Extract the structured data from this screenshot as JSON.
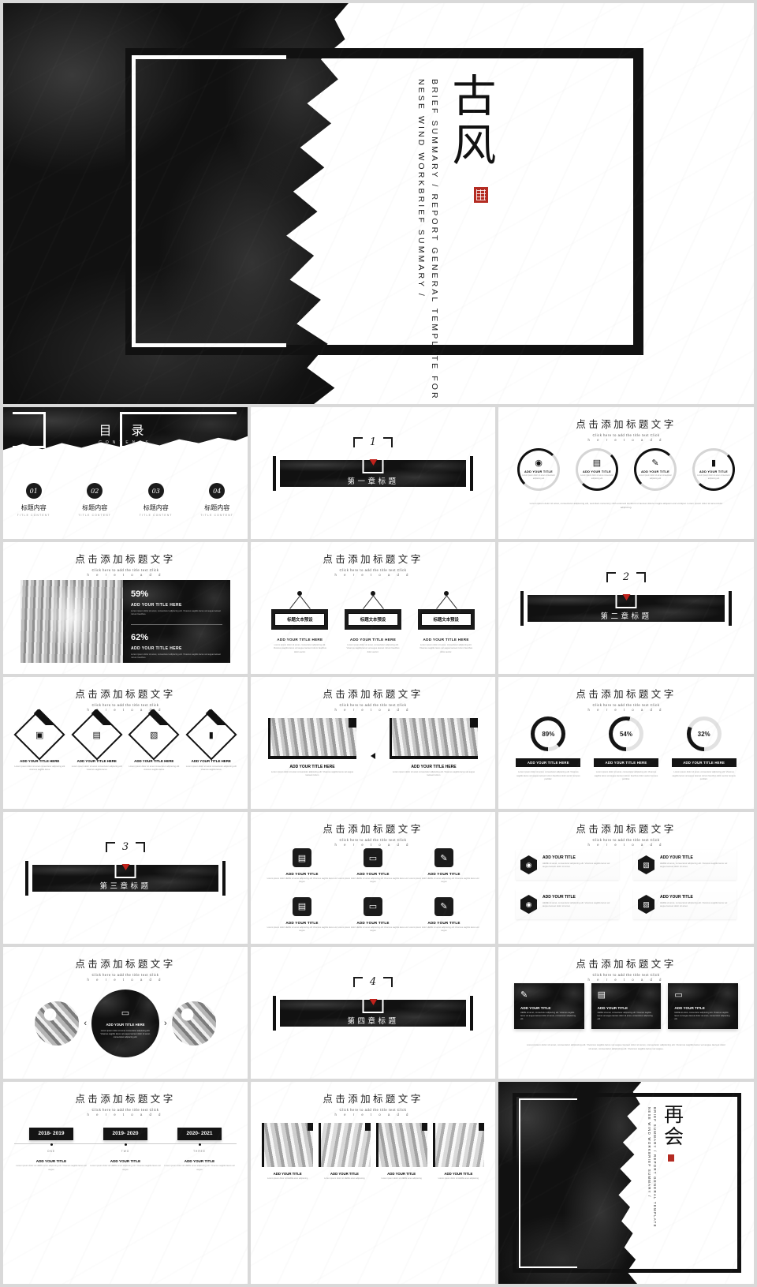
{
  "cover": {
    "title_cn": "古风",
    "vertical_line_1": "BRIEF SUMMARY / REPORT GENERAL TEMPLATE FOR",
    "vertical_line_2": "NESE WIND WORKBRIEF SUMMARY /",
    "seal_name": "red-seal-stamp"
  },
  "toc": {
    "title_cn": "目 录",
    "title_en": "CONTENTS",
    "items": [
      {
        "num": "01",
        "cn": "标题内容",
        "en": "TITLE CONTENT"
      },
      {
        "num": "02",
        "cn": "标题内容",
        "en": "TITLE CONTENT"
      },
      {
        "num": "03",
        "cn": "标题内容",
        "en": "TITLE CONTENT"
      },
      {
        "num": "04",
        "cn": "标题内容",
        "en": "TITLE CONTENT"
      }
    ]
  },
  "section_header": {
    "cn": "点击添加标题文字",
    "en_line1": "Click here to add the title text Click",
    "en_line2": "h e r e   t o   a d d"
  },
  "chapters": [
    {
      "num": "1",
      "title": "第一章标题"
    },
    {
      "num": "2",
      "title": "第二章标题"
    },
    {
      "num": "3",
      "title": "第三章标题"
    },
    {
      "num": "4",
      "title": "第四章标题"
    }
  ],
  "lorem_short": "Lorem ipsum dolor sit amet, consectetur adipiscing elit. Vivamus sagittis lacus vel augue.",
  "lorem_medium": "Lorem ipsum dolor sit amet, consectetur adipiscing elit. Vivamus sagittis lacus vel augue laoreet rutrum faucibus dolor auctor.",
  "lorem_long": "Lorem ipsum dolor sit amet, consectetur adipiscing elit. Vivamus sagittis lacus vel augue laoreet rutrum faucibus dolor auctor. Lorem ipsum dolor sit amet, consectetur adipiscing elit. Vivamus sagittis lacus vel augue laoreet rutrum faucibus dolor auctor.",
  "circles_slide": {
    "items": [
      {
        "icon": "search-target-icon",
        "glyph": "◉",
        "title": "ADD YOUR TITLE",
        "desc": "Lorem ipsum dolor sit amet consectetur adipiscing elit"
      },
      {
        "icon": "layers-icon",
        "glyph": "▤",
        "title": "ADD YOUR TITLE",
        "desc": "Lorem ipsum dolor sit amet consectetur adipiscing elit"
      },
      {
        "icon": "edit-document-icon",
        "glyph": "✎",
        "title": "ADD YOUR TITLE",
        "desc": "Lorem ipsum dolor sit amet consectetur adipiscing elit"
      },
      {
        "icon": "bar-chart-icon",
        "glyph": "▮",
        "title": "ADD YOUR TITLE",
        "desc": "Lorem ipsum dolor sit amet consectetur adipiscing elit"
      }
    ],
    "footer": "Lorem ipsum dolor sit amet, consectetur adipiscing elit, sed diam nonummy nibh euismod tincidunt ut laoreet dolore magna aliquam erat volutpat. Lorem ipsum dolor sit amet dolor adipiscing."
  },
  "stats_slide": {
    "stats": [
      {
        "value": "59%",
        "title": "ADD YOUR TITLE HERE",
        "desc": "Lorem ipsum dolor sit amet, consectetur adipiscing elit. Vivamus sagittis lacus vel augue laoreet rutrum faucibus."
      },
      {
        "value": "62%",
        "title": "ADD YOUR TITLE HERE",
        "desc": "Lorem ipsum dolor sit amet, consectetur adipiscing elit. Vivamus sagittis lacus vel augue laoreet rutrum faucibus."
      }
    ],
    "photo_name": "architecture-corridor-photo"
  },
  "tags_slide": {
    "tags": [
      {
        "plate": "标题文本预设",
        "title": "ADD YOUR TITLE HERE",
        "desc": "Lorem ipsum dolor sit amet, consectetur adipiscing elit. Vivamus sagittis lacus vel augue laoreet rutrum faucibus dolor auctor."
      },
      {
        "plate": "标题文本预设",
        "title": "ADD YOUR TITLE HERE",
        "desc": "Lorem ipsum dolor sit amet, consectetur adipiscing elit. Vivamus sagittis lacus vel augue laoreet rutrum faucibus dolor auctor."
      },
      {
        "plate": "标题文本预设",
        "title": "ADD YOUR TITLE HERE",
        "desc": "Lorem ipsum dolor sit amet, consectetur adipiscing elit. Vivamus sagittis lacus vel augue laoreet rutrum faucibus dolor auctor."
      }
    ]
  },
  "diamonds_slide": {
    "items": [
      {
        "icon": "briefcase-icon",
        "glyph": "▣",
        "title": "ADD YOUR TITLE HERE",
        "desc": "Lorem ipsum dolor sit amet consectetur adipiscing elit vivamus sagittis lacus"
      },
      {
        "icon": "layers-icon",
        "glyph": "▤",
        "title": "ADD YOUR TITLE HERE",
        "desc": "Lorem ipsum dolor sit amet consectetur adipiscing elit vivamus sagittis lacus"
      },
      {
        "icon": "inbox-icon",
        "glyph": "▧",
        "title": "ADD YOUR TITLE HERE",
        "desc": "Lorem ipsum dolor sit amet consectetur adipiscing elit vivamus sagittis lacus"
      },
      {
        "icon": "bar-chart-icon",
        "glyph": "▮",
        "title": "ADD YOUR TITLE HERE",
        "desc": "Lorem ipsum dolor sit amet consectetur adipiscing elit vivamus sagittis lacus"
      }
    ]
  },
  "compare_slide": {
    "items": [
      {
        "title": "ADD YOUR TITLE HERE",
        "desc": "Lorem ipsum dolor sit amet consectetur adipiscing elit. Vivamus sagittis lacus vel augue laoreet rutrum"
      },
      {
        "title": "ADD YOUR TITLE HERE",
        "desc": "Lorem ipsum dolor sit amet consectetur adipiscing elit. Vivamus sagittis lacus vel augue laoreet rutrum"
      }
    ]
  },
  "chart_data": {
    "type": "pie",
    "title": "点击添加标题文字",
    "subtitle": "Click here to add the title text Click here to add",
    "categories": [
      "ADD YOUR TITLE HERE",
      "ADD YOUR TITLE HERE",
      "ADD YOUR TITLE HERE"
    ],
    "values": [
      89,
      54,
      32
    ],
    "labels": [
      "89%",
      "54%",
      "32%"
    ],
    "unit": "%",
    "ylim": [
      0,
      100
    ],
    "legend": "none",
    "grid": false,
    "descriptions": [
      "Lorem ipsum dolor sit amet, consectetur adipiscing elit. Vivamus sagittis lacus vel augue laoreet rutrum faucibus dolor auctor tempus porttitor.",
      "Lorem ipsum dolor sit amet, consectetur adipiscing elit. Vivamus sagittis lacus vel augue laoreet rutrum faucibus dolor auctor tempus porttitor.",
      "Lorem ipsum dolor sit amet, consectetur adipiscing elit. Vivamus sagittis lacus vel augue laoreet rutrum faucibus dolor auctor tempus porttitor."
    ]
  },
  "icon_grid_slide": {
    "items": [
      {
        "icon": "layers-icon",
        "glyph": "▤",
        "title": "ADD YOUR TITLE",
        "desc": "Lorem ipsum dolor HERE sit amet adipiscing elit Vivamus sagittis lacus vel augue"
      },
      {
        "icon": "monitor-icon",
        "glyph": "▭",
        "title": "ADD YOUR TITLE",
        "desc": "Lorem ipsum dolor HERE sit amet adipiscing elit Vivamus sagittis lacus vel augue"
      },
      {
        "icon": "edit-document-icon",
        "glyph": "✎",
        "title": "ADD YOUR TITLE",
        "desc": "Lorem ipsum dolor HERE sit amet adipiscing elit Vivamus sagittis lacus vel augue"
      },
      {
        "icon": "layers-icon",
        "glyph": "▤",
        "title": "ADD YOUR TITLE",
        "desc": "Lorem ipsum dolor HERE sit amet adipiscing elit Vivamus sagittis lacus vel augue"
      },
      {
        "icon": "monitor-icon",
        "glyph": "▭",
        "title": "ADD YOUR TITLE",
        "desc": "Lorem ipsum dolor HERE sit amet adipiscing elit Vivamus sagittis lacus vel augue"
      },
      {
        "icon": "edit-document-icon",
        "glyph": "✎",
        "title": "ADD YOUR TITLE",
        "desc": "Lorem ipsum dolor HERE sit amet adipiscing elit Vivamus sagittis lacus vel augue"
      }
    ]
  },
  "hexagon_slide": {
    "items": [
      {
        "icon": "search-target-icon",
        "glyph": "◉",
        "title": "ADD YOUR TITLE",
        "desc": "HERE sit amet, consectetur adipiscing elit. Vivamus sagittis lacus vel augue laoreet dolor sit amet."
      },
      {
        "icon": "inbox-icon",
        "glyph": "▧",
        "title": "ADD YOUR TITLE",
        "desc": "HERE sit amet, consectetur adipiscing elit. Vivamus sagittis lacus vel augue laoreet dolor sit amet."
      },
      {
        "icon": "search-target-icon",
        "glyph": "◉",
        "title": "ADD YOUR TITLE",
        "desc": "HERE sit amet, consectetur adipiscing elit. Vivamus sagittis lacus vel augue laoreet dolor sit amet."
      },
      {
        "icon": "inbox-icon",
        "glyph": "▧",
        "title": "ADD YOUR TITLE",
        "desc": "HERE sit amet, consectetur adipiscing elit. Vivamus sagittis lacus vel augue laoreet dolor sit amet."
      }
    ]
  },
  "carousel_slide": {
    "prev_label": "‹",
    "next_label": "›",
    "center": {
      "icon": "monitor-icon",
      "glyph": "▭",
      "title": "ADD YOUR TITLE HERE",
      "desc": "Lorem ipsum dolor sit amet consectetur adipiscing elit. Vivamus sagittis lacus vel augue laoreet dolor sit amet, consectetur adipiscing elit."
    },
    "left_image": "sailboat-photo",
    "right_image": "sailboat-photo"
  },
  "dark_cards_slide": {
    "cards": [
      {
        "icon": "edit-document-icon",
        "glyph": "✎",
        "title": "ADD YOUR TITLE",
        "desc": "HERE sit amet, consectetur adipiscing elit. Vivamus sagittis lacus vel augue laoreet dolor sit amet, consectetur adipiscing elit."
      },
      {
        "icon": "layers-icon",
        "glyph": "▤",
        "title": "ADD YOUR TITLE",
        "desc": "HERE sit amet, consectetur adipiscing elit. Vivamus sagittis lacus vel augue laoreet dolor sit amet, consectetur adipiscing elit."
      },
      {
        "icon": "chat-icon",
        "glyph": "▭",
        "title": "ADD YOUR TITLE",
        "desc": "HERE sit amet, consectetur adipiscing elit. Vivamus sagittis lacus vel augue laoreet dolor sit amet, consectetur adipiscing elit."
      }
    ],
    "footer": "Lorem ipsum dolor sit amet, consectetur adipiscing elit. Vivamus sagittis lacus vel augue laoreet dolor sit amet, consectetur adipiscing elit. Vivamus sagittis lacus vel augue laoreet dolor sit amet, consectetur adipiscing elit. Vivamus sagittis lacus vel augue."
  },
  "timeline_slide": {
    "items": [
      {
        "year": "2018-\n2019",
        "order": "ONE",
        "title": "ADD YOUR TITLE",
        "desc": "Lorem ipsum dolor sit HERE amet adipiscing elit. Vivamus sagittis lacus vel augue"
      },
      {
        "year": "2019-\n2020",
        "order": "TWO",
        "title": "ADD YOUR TITLE",
        "desc": "Lorem ipsum dolor sit HERE amet adipiscing elit. Vivamus sagittis lacus vel augue"
      },
      {
        "year": "2020-\n2021",
        "order": "THREE",
        "title": "ADD YOUR TITLE",
        "desc": "Lorem ipsum dolor sit HERE amet adipiscing elit. Vivamus sagittis lacus vel augue"
      }
    ]
  },
  "gallery_slide": {
    "items": [
      {
        "title": "ADD YOUR TITLE",
        "desc": "Lorem ipsum dolor sit HERE amet adipiscing"
      },
      {
        "title": "ADD YOUR TITLE",
        "desc": "Lorem ipsum dolor sit HERE amet adipiscing"
      },
      {
        "title": "ADD YOUR TITLE",
        "desc": "Lorem ipsum dolor sit HERE amet adipiscing"
      },
      {
        "title": "ADD YOUR TITLE",
        "desc": "Lorem ipsum dolor sit HERE amet adipiscing"
      }
    ]
  },
  "ending": {
    "title_cn": "再会",
    "vertical_line_1": "BRIEF SUMMARY / REPORT GENERAL TEMPLATE",
    "vertical_line_2": "NESE WIND WORKBRIEF SUMMARY /",
    "seal_name": "red-seal-stamp"
  },
  "colors": {
    "ink_black": "#111111",
    "seal_red": "#b42b22",
    "accent_red": "#c0221c",
    "page_gap": "#d9d9d9"
  }
}
